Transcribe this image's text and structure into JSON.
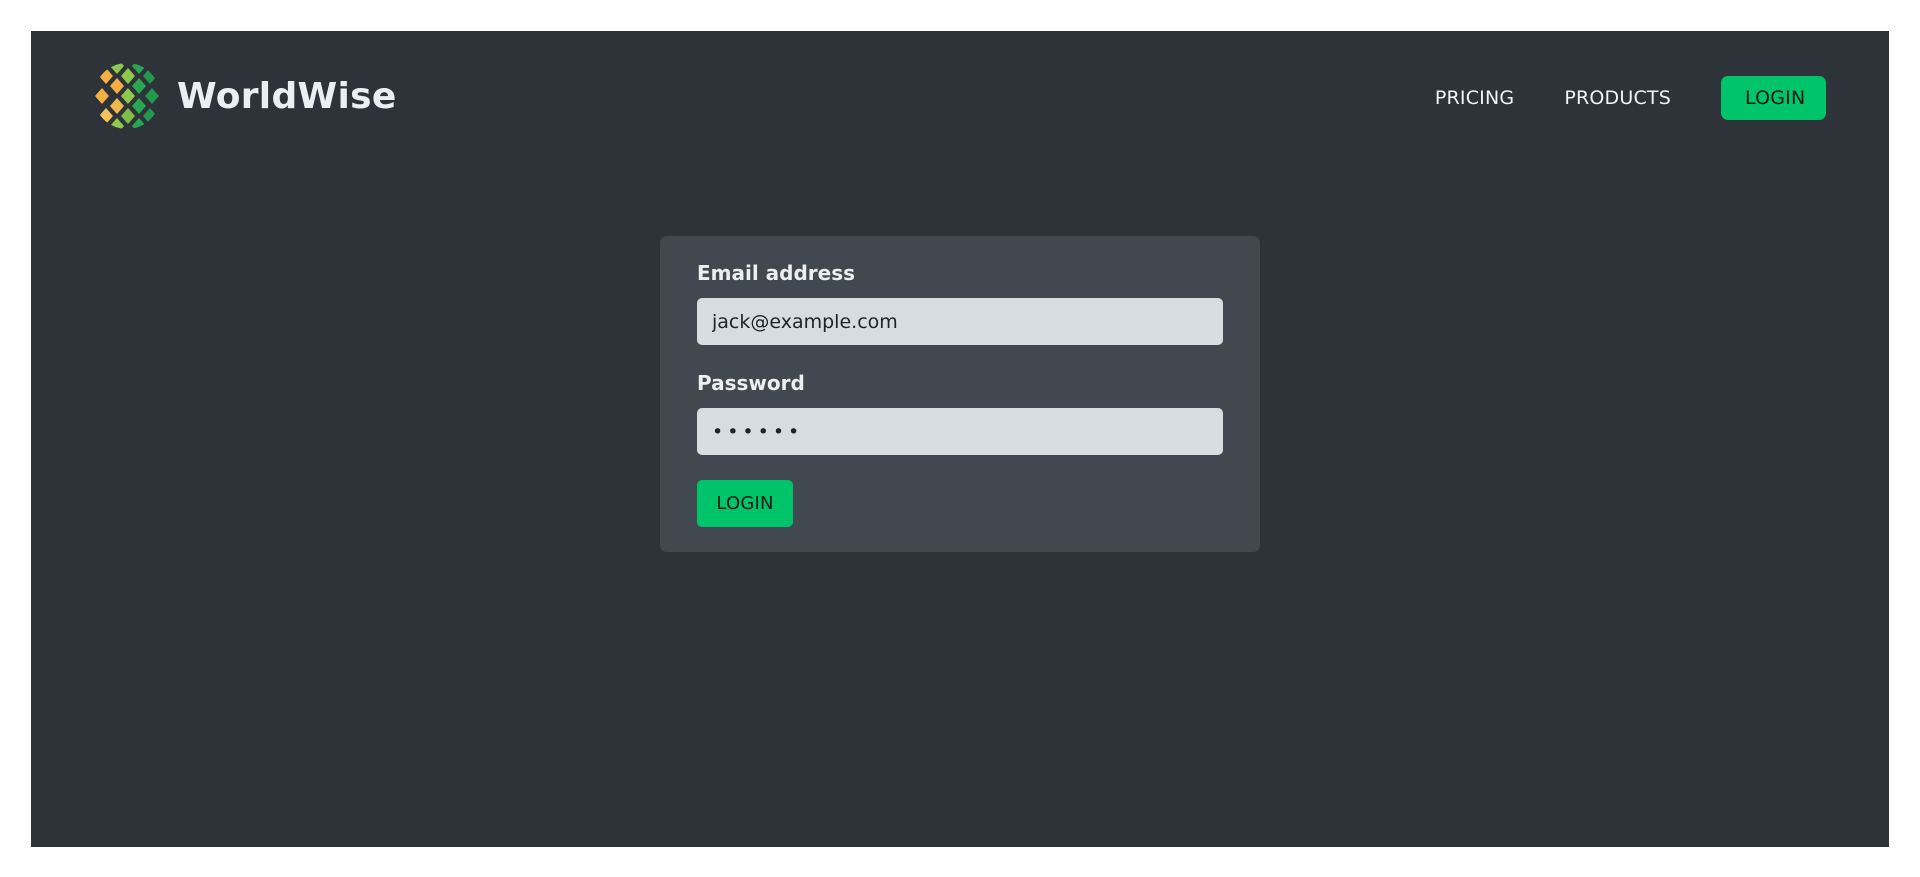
{
  "brand": {
    "name": "WorldWise",
    "logo_icon": "globe-mosaic-icon",
    "logo_colors": [
      "#f5b041",
      "#8fc94a",
      "#2aa64f"
    ]
  },
  "nav": {
    "links": [
      {
        "label": "PRICING"
      },
      {
        "label": "PRODUCTS"
      }
    ],
    "login_label": "LOGIN"
  },
  "form": {
    "email": {
      "label": "Email address",
      "value": "jack@example.com"
    },
    "password": {
      "label": "Password",
      "value": "qwerty"
    },
    "submit_label": "LOGIN"
  },
  "colors": {
    "background": "#2d3339",
    "card": "#42484f",
    "input": "#d6dcdf",
    "accent": "#00c46a"
  }
}
